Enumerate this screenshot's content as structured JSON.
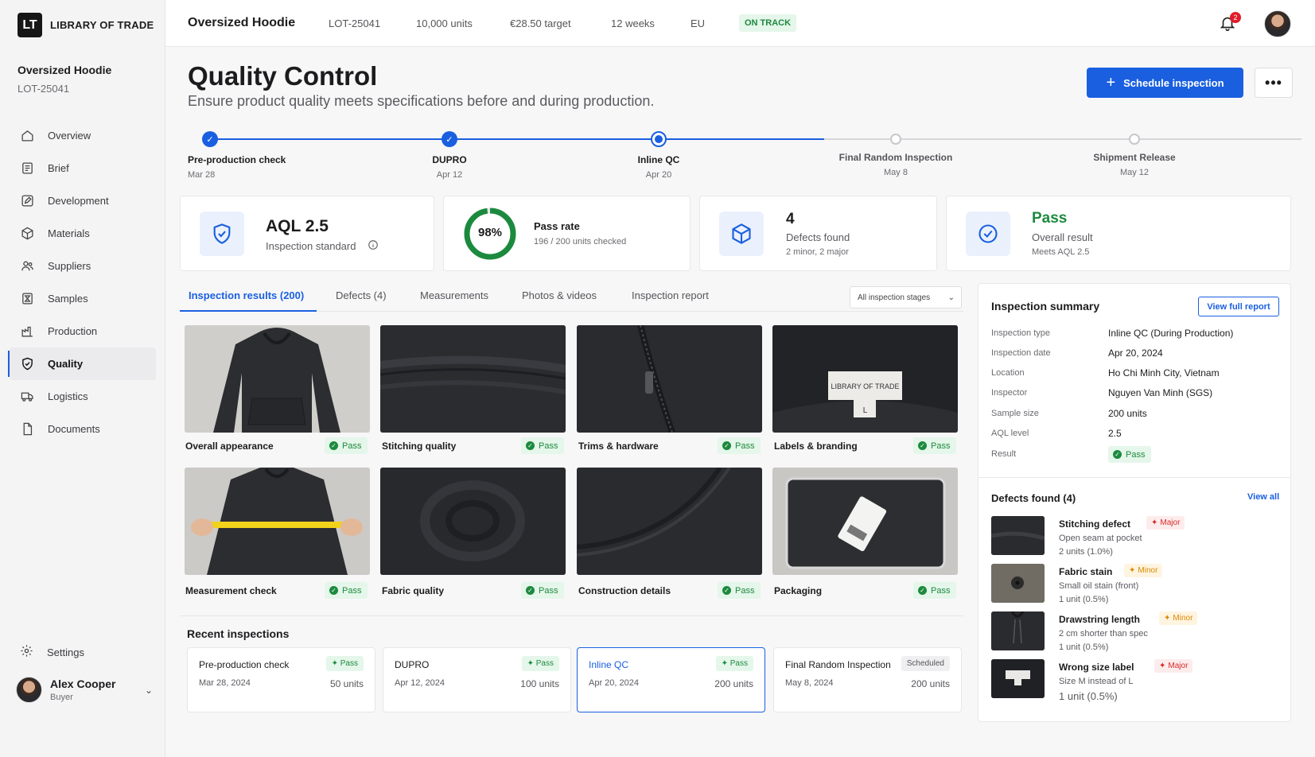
{
  "brand": {
    "mark": "LT",
    "name": "LIBRARY OF TRADE"
  },
  "project": {
    "name": "Oversized Hoodie",
    "lot": "LOT-25041"
  },
  "sidebar": {
    "items": [
      {
        "label": "Overview",
        "icon": "home-icon"
      },
      {
        "label": "Brief",
        "icon": "document-list-icon"
      },
      {
        "label": "Development",
        "icon": "pencil-icon"
      },
      {
        "label": "Materials",
        "icon": "cube-icon"
      },
      {
        "label": "Suppliers",
        "icon": "users-icon"
      },
      {
        "label": "Samples",
        "icon": "hourglass-icon"
      },
      {
        "label": "Production",
        "icon": "factory-icon"
      },
      {
        "label": "Quality",
        "icon": "shield-check-icon",
        "active": true
      },
      {
        "label": "Logistics",
        "icon": "truck-icon"
      },
      {
        "label": "Documents",
        "icon": "file-icon"
      }
    ],
    "settings": "Settings",
    "user": {
      "name": "Alex Cooper",
      "role": "Buyer"
    }
  },
  "topbar": {
    "title": "Oversized Hoodie",
    "lot": "LOT-25041",
    "units": "10,000 units",
    "target": "€28.50 target",
    "weeks": "12 weeks",
    "region": "EU",
    "status": "ON TRACK",
    "notifications": "2"
  },
  "header": {
    "title": "Quality Control",
    "subtitle": "Ensure product quality meets specifications before and during production.",
    "primary_button": "Schedule inspection",
    "more_button": "•••"
  },
  "steps": [
    {
      "label": "Pre-production check",
      "date": "Mar 28",
      "state": "done"
    },
    {
      "label": "DUPRO",
      "date": "Apr 12",
      "state": "done"
    },
    {
      "label": "Inline QC",
      "date": "Apr 20",
      "state": "current"
    },
    {
      "label": "Final Random Inspection",
      "date": "May 8",
      "state": "todo"
    },
    {
      "label": "Shipment Release",
      "date": "May 12",
      "state": "todo"
    }
  ],
  "stats": {
    "aql": {
      "value": "AQL 2.5",
      "label": "Inspection standard"
    },
    "pass_rate": {
      "value": "98%",
      "fraction": 0.98,
      "label": "Pass rate",
      "detail": "196 / 200 units checked"
    },
    "defects": {
      "value": "4",
      "label": "Defects found",
      "detail": "2 minor, 2 major"
    },
    "result": {
      "value": "Pass",
      "label": "Overall result",
      "detail": "Meets AQL 2.5"
    }
  },
  "tabs": [
    {
      "label": "Inspection results (200)",
      "active": true
    },
    {
      "label": "Defects (4)"
    },
    {
      "label": "Measurements"
    },
    {
      "label": "Photos & videos"
    },
    {
      "label": "Inspection report"
    }
  ],
  "stage_filter": "All inspection stages",
  "photos": [
    {
      "caption": "Overall appearance",
      "status": "Pass",
      "label_text": ""
    },
    {
      "caption": "Stitching quality",
      "status": "Pass",
      "label_text": ""
    },
    {
      "caption": "Trims & hardware",
      "status": "Pass",
      "label_text": ""
    },
    {
      "caption": "Labels & branding",
      "status": "Pass",
      "label_text": "LIBRARY OF TRADE",
      "size_text": "L"
    },
    {
      "caption": "Measurement check",
      "status": "Pass",
      "label_text": ""
    },
    {
      "caption": "Fabric quality",
      "status": "Pass",
      "label_text": ""
    },
    {
      "caption": "Construction details",
      "status": "Pass",
      "label_text": ""
    },
    {
      "caption": "Packaging",
      "status": "Pass",
      "label_text": ""
    }
  ],
  "recent": {
    "title": "Recent inspections",
    "items": [
      {
        "name": "Pre-production check",
        "date": "Mar 28, 2024",
        "units": "50 units",
        "status": "Pass"
      },
      {
        "name": "DUPRO",
        "date": "Apr 12, 2024",
        "units": "100 units",
        "status": "Pass"
      },
      {
        "name": "Inline QC",
        "date": "Apr 20, 2024",
        "units": "200 units",
        "status": "Pass",
        "selected": true
      },
      {
        "name": "Final Random Inspection",
        "date": "May 8, 2024",
        "units": "200 units",
        "status": "Scheduled"
      }
    ]
  },
  "summary": {
    "title": "Inspection summary",
    "button": "View full report",
    "rows": [
      {
        "label": "Inspection type",
        "value": "Inline QC (During Production)"
      },
      {
        "label": "Inspection date",
        "value": "Apr 20, 2024"
      },
      {
        "label": "Location",
        "value": "Ho Chi Minh City, Vietnam"
      },
      {
        "label": "Inspector",
        "value": "Nguyen Van Minh (SGS)"
      },
      {
        "label": "Sample size",
        "value": "200 units"
      },
      {
        "label": "AQL level",
        "value": "2.5"
      },
      {
        "label": "Result",
        "value": "Pass"
      }
    ]
  },
  "defects": {
    "title": "Defects found (4)",
    "view_all": "View all",
    "items": [
      {
        "name": "Stitching defect",
        "severity": "Major",
        "desc": "Open seam at pocket",
        "units": "2 units (1.0%)"
      },
      {
        "name": "Fabric stain",
        "severity": "Minor",
        "desc": "Small oil stain (front)",
        "units": "1 unit (0.5%)"
      },
      {
        "name": "Drawstring length",
        "severity": "Minor",
        "desc": "2 cm shorter than spec",
        "units": "1 unit (0.5%)"
      },
      {
        "name": "Wrong size label",
        "severity": "Major",
        "desc": "Size M instead of L",
        "units": "1 unit (0.5%)"
      }
    ]
  },
  "colors": {
    "accent": "#1a5fe0",
    "pass": "#1c8a3e",
    "major": "#d42a2a",
    "minor": "#d98a00"
  }
}
